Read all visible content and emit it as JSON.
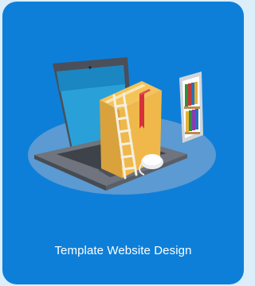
{
  "card": {
    "caption": "Template Website Design",
    "background_color": "#0e7fd8",
    "illustration": {
      "subject": "isometric laptop with books and ladder",
      "icons": [
        "laptop-icon",
        "book-icon",
        "ladder-icon",
        "mouse-icon",
        "phone-icon",
        "bookshelf-icon"
      ]
    }
  }
}
